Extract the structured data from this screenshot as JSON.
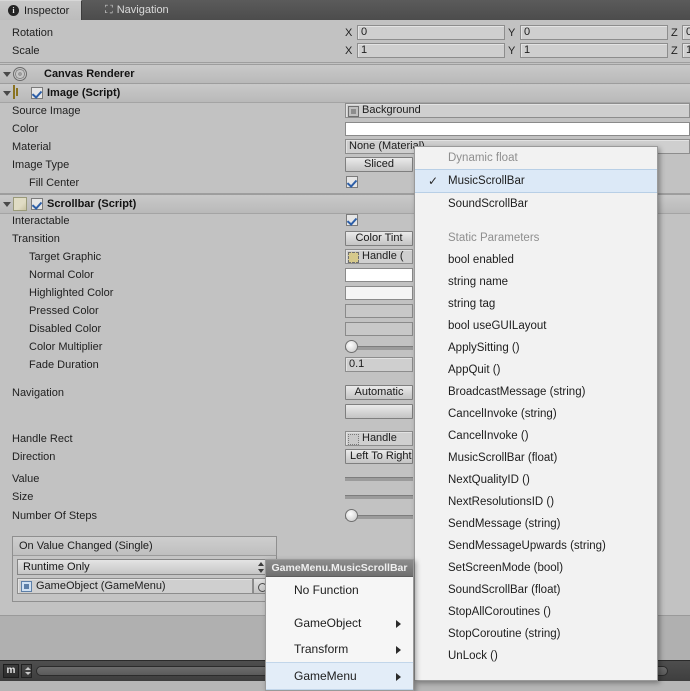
{
  "window": {
    "tabs": [
      {
        "id": "inspector",
        "label": "Inspector",
        "icon": "info-icon",
        "active": true
      },
      {
        "id": "navigation",
        "label": "Navigation",
        "icon": "navigation-icon",
        "active": false
      }
    ]
  },
  "transform": {
    "rows": [
      {
        "label": "Rotation",
        "x_axis": "X",
        "x_value": "0",
        "y_axis": "Y",
        "y_value": "0",
        "z_axis": "Z",
        "z_value": "0"
      },
      {
        "label": "Scale",
        "x_axis": "X",
        "x_value": "1",
        "y_axis": "Y",
        "y_value": "1",
        "z_axis": "Z",
        "z_value": "1"
      }
    ]
  },
  "canvas_renderer": {
    "title": "Canvas Renderer"
  },
  "image_component": {
    "title": "Image (Script)",
    "enabled": true,
    "source_image_label": "Source Image",
    "source_image_value": "Background",
    "color_label": "Color",
    "color_value": "#FFFFFF",
    "material_label": "Material",
    "material_value": "None (Material)",
    "image_type_label": "Image Type",
    "image_type_value": "Sliced",
    "fill_center_label": "Fill Center",
    "fill_center_checked": true
  },
  "scrollbar_component": {
    "title": "Scrollbar (Script)",
    "enabled": true,
    "interactable_label": "Interactable",
    "interactable_checked": true,
    "transition_label": "Transition",
    "transition_value": "Color Tint",
    "target_graphic_label": "Target Graphic",
    "target_graphic_value": "Handle (",
    "normal_color_label": "Normal Color",
    "normal_color_value": "#FFFFFF",
    "highlighted_color_label": "Highlighted Color",
    "highlighted_color_value": "#F5F5F5",
    "pressed_color_label": "Pressed Color",
    "pressed_color_value": "#C8C8C8",
    "disabled_color_label": "Disabled Color",
    "disabled_color_value": "#C8C8C8",
    "color_multiplier_label": "Color Multiplier",
    "fade_duration_label": "Fade Duration",
    "fade_duration_value": "0.1",
    "navigation_label": "Navigation",
    "navigation_value": "Automatic",
    "visualize_label": "",
    "handle_rect_label": "Handle Rect",
    "handle_rect_value": "Handle",
    "direction_label": "Direction",
    "direction_value": "Left To Right",
    "value_label": "Value",
    "size_label": "Size",
    "number_of_steps_label": "Number Of Steps"
  },
  "event_box": {
    "header": "On Value Changed (Single)",
    "callback_mode": "Runtime Only",
    "target_object": "GameObject (GameMenu)"
  },
  "function_menu": {
    "sections": [
      {
        "header": "Dynamic float",
        "items": [
          {
            "label": "MusicScrollBar",
            "checked": true
          },
          {
            "label": "SoundScrollBar",
            "checked": false
          }
        ]
      },
      {
        "header": "Static Parameters",
        "items": [
          {
            "label": "bool enabled",
            "checked": false
          },
          {
            "label": "string name",
            "checked": false
          },
          {
            "label": "string tag",
            "checked": false
          },
          {
            "label": "bool useGUILayout",
            "checked": false
          },
          {
            "label": "ApplySitting ()",
            "checked": false
          },
          {
            "label": "AppQuit ()",
            "checked": false
          },
          {
            "label": "BroadcastMessage (string)",
            "checked": false
          },
          {
            "label": "CancelInvoke (string)",
            "checked": false
          },
          {
            "label": "CancelInvoke ()",
            "checked": false
          },
          {
            "label": "MusicScrollBar (float)",
            "checked": false
          },
          {
            "label": "NextQualityID ()",
            "checked": false
          },
          {
            "label": "NextResolutionsID ()",
            "checked": false
          },
          {
            "label": "SendMessage (string)",
            "checked": false
          },
          {
            "label": "SendMessageUpwards (string)",
            "checked": false
          },
          {
            "label": "SetScreenMode (bool)",
            "checked": false
          },
          {
            "label": "SoundScrollBar (float)",
            "checked": false
          },
          {
            "label": "StopAllCoroutines ()",
            "checked": false
          },
          {
            "label": "StopCoroutine (string)",
            "checked": false
          },
          {
            "label": "UnLock ()",
            "checked": false
          }
        ]
      }
    ]
  },
  "context_menu": {
    "title": "GameMenu.MusicScrollBar",
    "items": [
      {
        "label": "No Function",
        "submenu": false,
        "highlighted": false
      },
      {
        "label": "GameObject",
        "submenu": true,
        "highlighted": false
      },
      {
        "label": "Transform",
        "submenu": true,
        "highlighted": false
      },
      {
        "label": "GameMenu",
        "submenu": true,
        "highlighted": true
      }
    ]
  },
  "status_bar": {
    "mode_badge": "m"
  }
}
